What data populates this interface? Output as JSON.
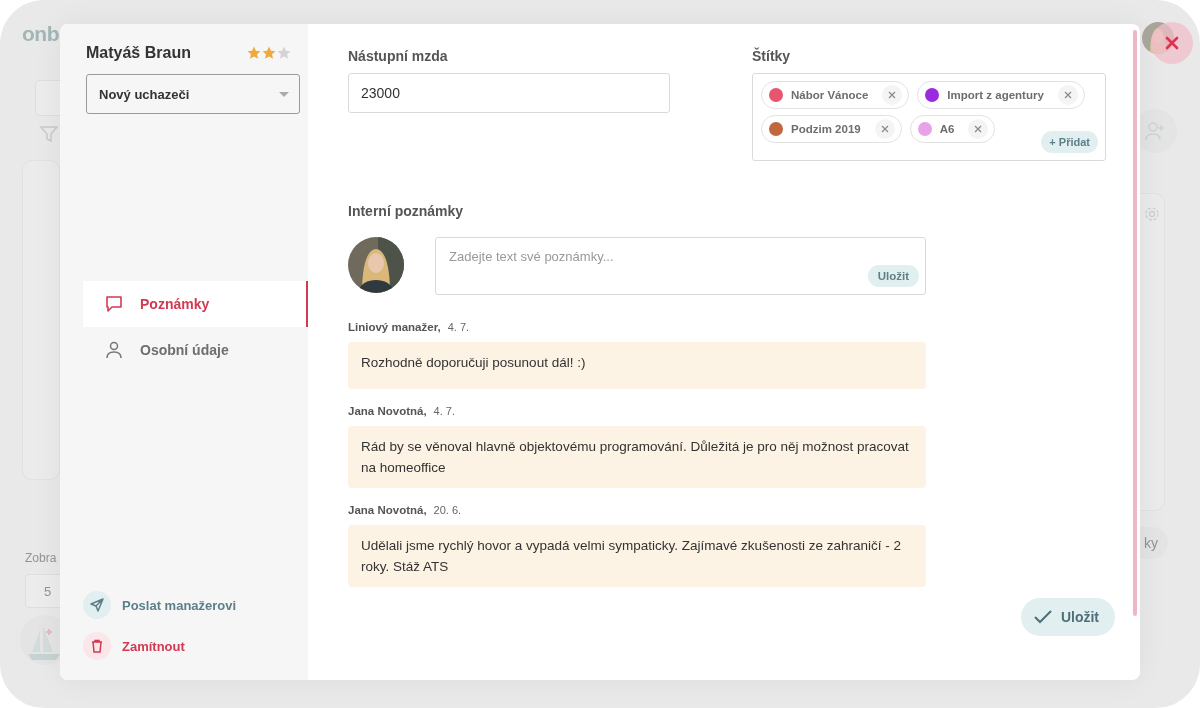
{
  "background": {
    "logo": "onb",
    "page_size_label": "Zobra",
    "page_size_value": "5",
    "button_fragment": "ky"
  },
  "candidate": {
    "name": "Matyáš Braun",
    "stars": 2,
    "stage": "Nový uchazeči"
  },
  "nav": [
    {
      "label": "Poznámky",
      "kind": "chat",
      "selected": true
    },
    {
      "label": "Osobní údaje",
      "kind": "person",
      "selected": false
    }
  ],
  "actions": [
    {
      "label": "Poslat manažerovi",
      "kind": "send"
    },
    {
      "label": "Zamítnout",
      "kind": "reject"
    }
  ],
  "salary": {
    "label": "Nástupní mzda",
    "value": "23000"
  },
  "tags": {
    "label": "Štítky",
    "add_button": "+ Přidat",
    "items": [
      {
        "name": "Nábor Vánoce",
        "color": "#e8566e"
      },
      {
        "name": "Import z agentury",
        "color": "#9b2be0"
      },
      {
        "name": "Podzim 2019",
        "color": "#c0673e"
      },
      {
        "name": "A6",
        "color": "#e8a3e8"
      }
    ]
  },
  "notes": {
    "label": "Interní poznámky",
    "placeholder": "Zadejte text své poznámky...",
    "submit": "Uložit",
    "items": [
      {
        "author": "Liniový manažer,",
        "date": "4. 7.",
        "text": "Rozhodně doporučuji posunout dál! :)"
      },
      {
        "author": "Jana Novotná,",
        "date": "4. 7.",
        "text": "Rád by se věnoval hlavně objektovému programování. Důležitá je pro něj možnost pracovat na homeoffice"
      },
      {
        "author": "Jana Novotná,",
        "date": "20. 6.",
        "text": "Udělali jsme rychlý hovor a vypadá velmi sympaticky. Zajímavé zkušenosti ze zahraničí - 2 roky. Stáž ATS"
      }
    ]
  },
  "save_button": "Uložit"
}
